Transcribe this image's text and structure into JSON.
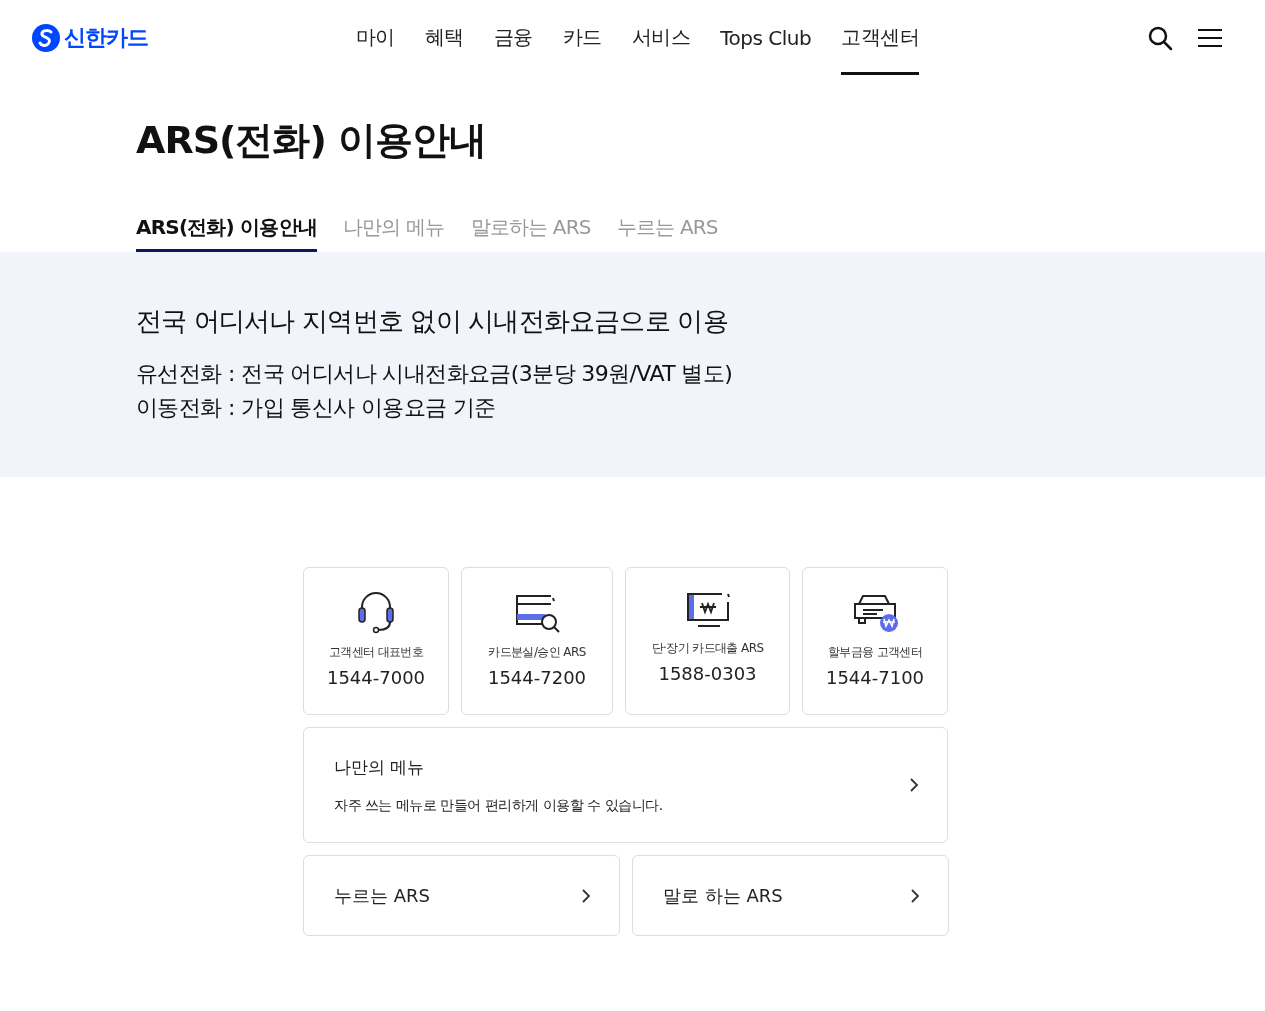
{
  "header": {
    "logo": "신한카드",
    "nav": [
      {
        "label": "마이",
        "selected": false
      },
      {
        "label": "혜택",
        "selected": false
      },
      {
        "label": "금융",
        "selected": false
      },
      {
        "label": "카드",
        "selected": false
      },
      {
        "label": "서비스",
        "selected": false
      },
      {
        "label": "Tops Club",
        "selected": false
      },
      {
        "label": "고객센터",
        "selected": true
      }
    ]
  },
  "page_title": "ARS(전화) 이용안내",
  "tabs": [
    {
      "label": "ARS(전화) 이용안내",
      "selected": true
    },
    {
      "label": "나만의 메뉴",
      "selected": false
    },
    {
      "label": "말로하는 ARS",
      "selected": false
    },
    {
      "label": "누르는 ARS",
      "selected": false
    }
  ],
  "banner": {
    "headline": "전국 어디서나 지역번호 없이 시내전화요금으로 이용",
    "lines": [
      "유선전화 : 전국 어디서나 시내전화요금(3분당 39원/VAT 별도)",
      "이동전화 : 가입 통신사 이용요금 기준"
    ]
  },
  "phone_cards": [
    {
      "kind": "headset",
      "label": "고객센터 대표번호",
      "number": "1544-7000"
    },
    {
      "kind": "card-search",
      "label": "카드분실/승인 ARS",
      "number": "1544-7200"
    },
    {
      "kind": "monitor",
      "label": "단·장기 카드대출 ARS",
      "number": "1588-0303"
    },
    {
      "kind": "car",
      "label": "할부금융 고객센터",
      "number": "1544-7100"
    }
  ],
  "my_menu": {
    "title": "나만의 메뉴",
    "description": "자주 쓰는 메뉴로 만들어 편리하게 이용할 수 있습니다."
  },
  "link_cards": [
    {
      "label": "누르는 ARS"
    },
    {
      "label": "말로 하는 ARS"
    }
  ]
}
